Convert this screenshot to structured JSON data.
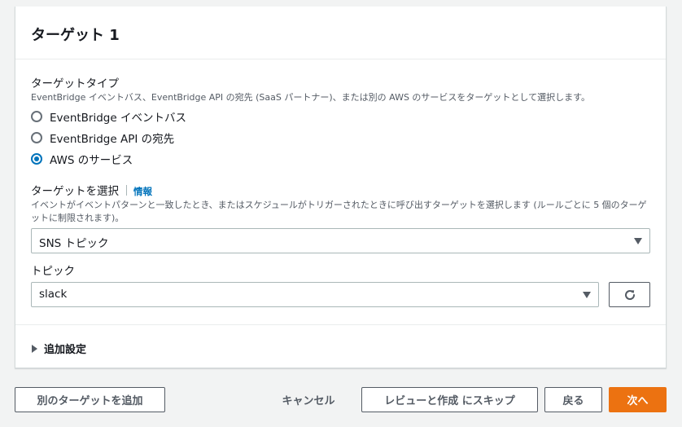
{
  "panel": {
    "title": "ターゲット 1"
  },
  "target_type": {
    "label": "ターゲットタイプ",
    "description": "EventBridge イベントバス、EventBridge API の宛先 (SaaS パートナー)、または別の AWS のサービスをターゲットとして選択します。",
    "options": [
      {
        "label": "EventBridge イベントバス",
        "checked": false
      },
      {
        "label": "EventBridge API の宛先",
        "checked": false
      },
      {
        "label": "AWS のサービス",
        "checked": true
      }
    ]
  },
  "select_target": {
    "label": "ターゲットを選択",
    "info": "情報",
    "description": "イベントがイベントパターンと一致したとき、またはスケジュールがトリガーされたときに呼び出すターゲットを選択します (ルールごとに 5 個のターゲットに制限されます)。",
    "value": "SNS トピック"
  },
  "topic": {
    "label": "トピック",
    "value": "slack"
  },
  "advanced": {
    "label": "追加設定"
  },
  "footer": {
    "add_target": "別のターゲットを追加",
    "cancel": "キャンセル",
    "skip_review": "レビューと作成 にスキップ",
    "back": "戻る",
    "next": "次へ"
  },
  "colors": {
    "primary": "#ec7211",
    "link": "#0073bb",
    "background": "#f2f3f3"
  }
}
